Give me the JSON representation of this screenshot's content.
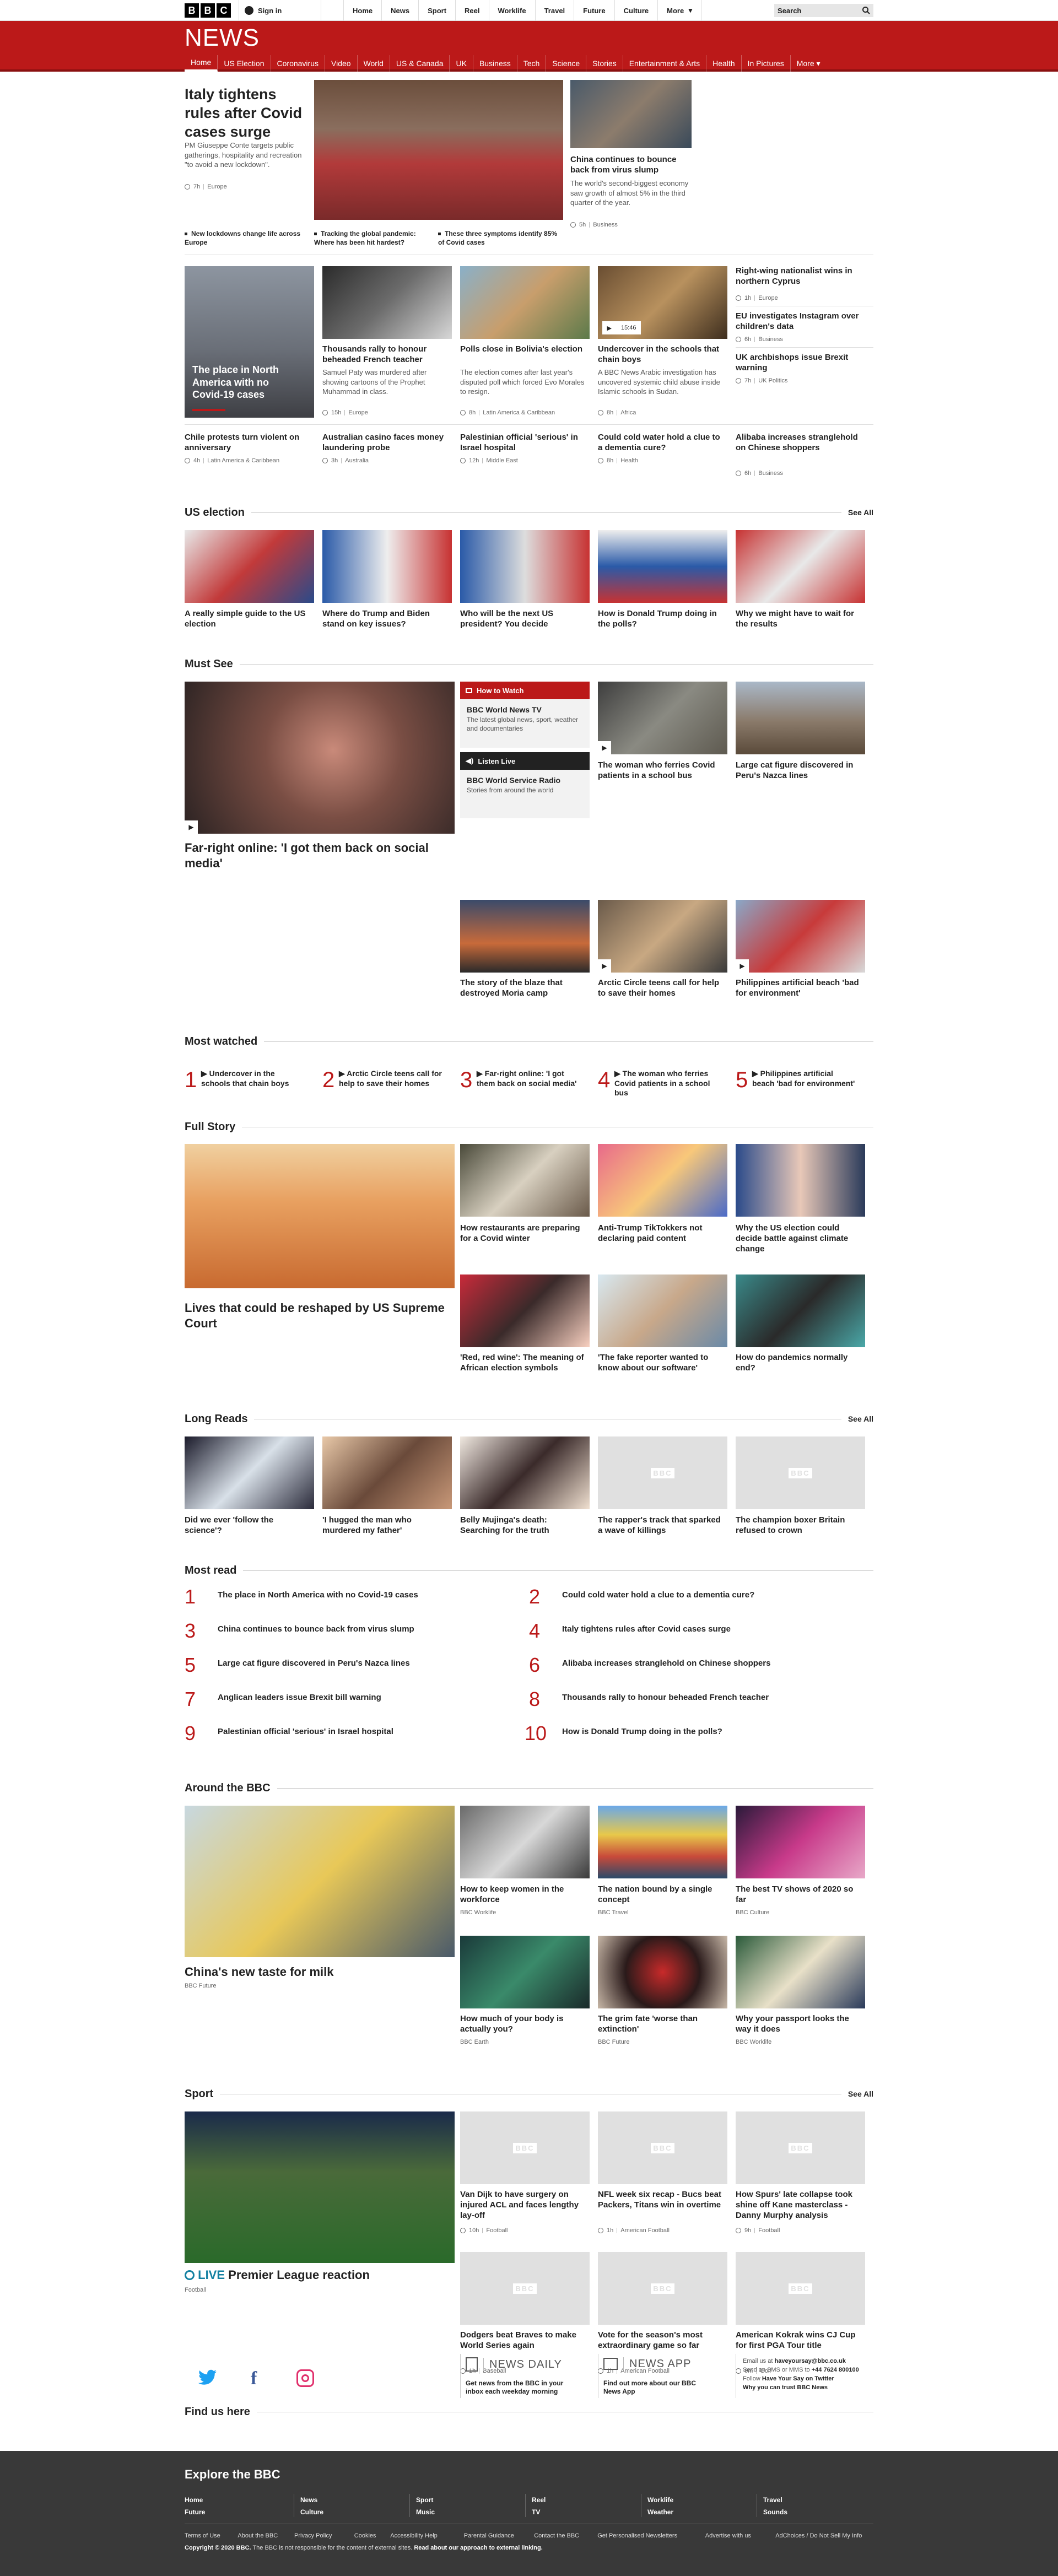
{
  "top": {
    "logo": [
      "B",
      "B",
      "C"
    ],
    "signin": "Sign in",
    "nav": [
      "Home",
      "News",
      "Sport",
      "Reel",
      "Worklife",
      "Travel",
      "Future",
      "Culture",
      "More"
    ],
    "more_caret": "▾",
    "search_placeholder": "Search",
    "search_icon": "search-icon"
  },
  "brand": "NEWS",
  "subnav": [
    "Home",
    "US Election",
    "Coronavirus",
    "Video",
    "World",
    "US & Canada",
    "UK",
    "Business",
    "Tech",
    "Science",
    "Stories",
    "Entertainment & Arts",
    "Health",
    "In Pictures",
    "More"
  ],
  "lead": {
    "title": "Italy tightens rules after Covid cases surge",
    "summary": "PM Giuseppe Conte targets public gatherings, hospitality and recreation \"to avoid a new lockdown\".",
    "time": "7h",
    "section": "Europe"
  },
  "second": {
    "title": "China continues to bounce back from virus slump",
    "summary": "The world's second-biggest economy saw growth of almost 5% in the third quarter of the year.",
    "time": "5h",
    "section": "Business"
  },
  "lead_bullets": [
    "New lockdowns change life across Europe",
    "Tracking the global pandemic: Where has been hit hardest?",
    "These three symptoms identify 85% of Covid cases"
  ],
  "row2": [
    {
      "title": "The place in North America with no Covid-19 cases"
    },
    {
      "title": "Thousands rally to honour beheaded French teacher",
      "summary": "Samuel Paty was murdered after showing cartoons of the Prophet Muhammad in class.",
      "time": "15h",
      "section": "Europe"
    },
    {
      "title": "Polls close in Bolivia's election",
      "summary": "The election comes after last year's disputed poll which forced Evo Morales to resign.",
      "time": "8h",
      "section": "Latin America & Caribbean"
    },
    {
      "title": "Undercover in the schools that chain boys",
      "summary": "A BBC News Arabic investigation has uncovered systemic child abuse inside Islamic schools in Sudan.",
      "time": "8h",
      "section": "Africa",
      "duration": "15:46"
    }
  ],
  "right_col": [
    {
      "title": "Right-wing nationalist wins in northern Cyprus",
      "time": "1h",
      "section": "Europe"
    },
    {
      "title": "EU investigates Instagram over children's data",
      "time": "6h",
      "section": "Business"
    },
    {
      "title": "UK archbishops issue Brexit warning",
      "time": "7h",
      "section": "UK Politics"
    }
  ],
  "row3": [
    {
      "title": "Chile protests turn violent on anniversary",
      "time": "4h",
      "section": "Latin America & Caribbean"
    },
    {
      "title": "Australian casino faces money laundering probe",
      "time": "3h",
      "section": "Australia"
    },
    {
      "title": "Palestinian official 'serious' in Israel hospital",
      "time": "12h",
      "section": "Middle East"
    },
    {
      "title": "Could cold water hold a clue to a dementia cure?",
      "time": "8h",
      "section": "Health"
    },
    {
      "title": "Alibaba increases stranglehold on Chinese shoppers",
      "time": "6h",
      "section": "Business"
    }
  ],
  "us_election": {
    "title": "US election",
    "see_all": "See All",
    "items": [
      "A really simple guide to the US election",
      "Where do Trump and Biden stand on key issues?",
      "Who will be the next US president? You decide",
      "How is Donald Trump doing in the polls?",
      "Why we might have to wait for the results"
    ]
  },
  "must_see": {
    "title": "Must See",
    "main": "Far-right online: 'I got them back on social media'",
    "how_to_watch": "How to Watch",
    "tv_title": "BBC World News TV",
    "tv_desc": "The latest global news, sport, weather and documentaries",
    "listen_live": "Listen Live",
    "radio_title": "BBC World Service Radio",
    "radio_desc": "Stories from around the world",
    "items": [
      "The woman who ferries Covid patients in a school bus",
      "Large cat figure discovered in Peru's Nazca lines",
      "The story of the blaze that destroyed Moria camp",
      "Arctic Circle teens call for help to save their homes",
      "Philippines artificial beach 'bad for environment'"
    ]
  },
  "most_watched": {
    "title": "Most watched",
    "items": [
      {
        "n": "1",
        "t": "Undercover in the schools that chain boys"
      },
      {
        "n": "2",
        "t": "Arctic Circle teens call for help to save their homes"
      },
      {
        "n": "3",
        "t": "Far-right online: 'I got them back on social media'"
      },
      {
        "n": "4",
        "t": "The woman who ferries Covid patients in a school bus"
      },
      {
        "n": "5",
        "t": "Philippines artificial beach 'bad for environment'"
      }
    ]
  },
  "full_story": {
    "title": "Full Story",
    "main": "Lives that could be reshaped by US Supreme Court",
    "items": [
      "How restaurants are preparing for a Covid winter",
      "Anti-Trump TikTokkers not declaring paid content",
      "Why the US election could decide battle against climate change",
      "'Red, red wine': The meaning of African election symbols",
      "'The fake reporter wanted to know about our software'",
      "How do pandemics normally end?"
    ]
  },
  "long_reads": {
    "title": "Long Reads",
    "see_all": "See All",
    "items": [
      "Did we ever 'follow the science'?",
      "'I hugged the man who murdered my father'",
      "Belly Mujinga's death: Searching for the truth",
      "The rapper's track that sparked a wave of killings",
      "The champion boxer Britain refused to crown"
    ],
    "placeholder": "BBC"
  },
  "most_read": {
    "title": "Most read",
    "items": [
      {
        "n": "1",
        "t": "The place in North America with no Covid-19 cases"
      },
      {
        "n": "2",
        "t": "Could cold water hold a clue to a dementia cure?"
      },
      {
        "n": "3",
        "t": "China continues to bounce back from virus slump"
      },
      {
        "n": "4",
        "t": "Italy tightens rules after Covid cases surge"
      },
      {
        "n": "5",
        "t": "Large cat figure discovered in Peru's Nazca lines"
      },
      {
        "n": "6",
        "t": "Alibaba increases stranglehold on Chinese shoppers"
      },
      {
        "n": "7",
        "t": "Anglican leaders issue Brexit bill warning"
      },
      {
        "n": "8",
        "t": "Thousands rally to honour beheaded French teacher"
      },
      {
        "n": "9",
        "t": "Palestinian official 'serious' in Israel hospital"
      },
      {
        "n": "10",
        "t": "How is Donald Trump doing in the polls?"
      }
    ]
  },
  "around": {
    "title": "Around the BBC",
    "main": {
      "t": "China's new taste for milk",
      "s": "BBC Future"
    },
    "items": [
      {
        "t": "How to keep women in the workforce",
        "s": "BBC Worklife"
      },
      {
        "t": "The nation bound by a single concept",
        "s": "BBC Travel"
      },
      {
        "t": "The best TV shows of 2020 so far",
        "s": "BBC Culture"
      },
      {
        "t": "How much of your body is actually you?",
        "s": "BBC Earth"
      },
      {
        "t": "The grim fate 'worse than extinction'",
        "s": "BBC Future"
      },
      {
        "t": "Why your passport looks the way it does",
        "s": "BBC Worklife"
      }
    ]
  },
  "sport": {
    "title": "Sport",
    "see_all": "See All",
    "live": "LIVE",
    "main": "Premier League reaction",
    "main_section": "Football",
    "items": [
      {
        "t": "Van Dijk to have surgery on injured ACL and faces lengthy lay-off",
        "time": "10h",
        "section": "Football"
      },
      {
        "t": "NFL week six recap - Bucs beat Packers, Titans win in overtime",
        "time": "1h",
        "section": "American Football"
      },
      {
        "t": "How Spurs' late collapse took shine off Kane masterclass - Danny Murphy analysis",
        "time": "9h",
        "section": "Football"
      },
      {
        "t": "Dodgers beat Braves to make World Series again",
        "time": "1h",
        "section": "Baseball"
      },
      {
        "t": "Vote for the season's most extraordinary game so far",
        "time": "1h",
        "section": "American Football"
      },
      {
        "t": "American Kokrak wins CJ Cup for first PGA Tour title",
        "time": "6m",
        "section": "Golf"
      }
    ]
  },
  "find_us": {
    "title": "Find us here",
    "news_daily": "NEWS DAILY",
    "news_daily_desc": "Get news from the BBC in your inbox each weekday morning",
    "news_app": "NEWS APP",
    "news_app_desc": "Find out more about our BBC News App",
    "email_prefix": "Email us at",
    "email": "haveyoursay@bbc.co.uk",
    "sms_prefix": "Send an SMS or MMS to",
    "sms": "+44 7624 800100",
    "follow_prefix": "Follow",
    "follow": "Have Your Say on Twitter",
    "trust": "Why you can trust BBC News"
  },
  "footer": {
    "title": "Explore the BBC",
    "links": [
      "Home",
      "News",
      "Sport",
      "Reel",
      "Worklife",
      "Travel",
      "Future",
      "Culture",
      "Music",
      "TV",
      "Weather",
      "Sounds"
    ],
    "small": [
      "Terms of Use",
      "About the BBC",
      "Privacy Policy",
      "Cookies",
      "Accessibility Help",
      "Parental Guidance",
      "Contact the BBC",
      "Get Personalised Newsletters",
      "Advertise with us",
      "AdChoices / Do Not Sell My Info"
    ],
    "copyright": "Copyright © 2020 BBC.",
    "copy_rest": "The BBC is not responsible for the content of external sites.",
    "copy_link": "Read about our approach to external linking."
  },
  "colors": {
    "brand_red": "#bb1919",
    "footer_bg": "#393939"
  }
}
